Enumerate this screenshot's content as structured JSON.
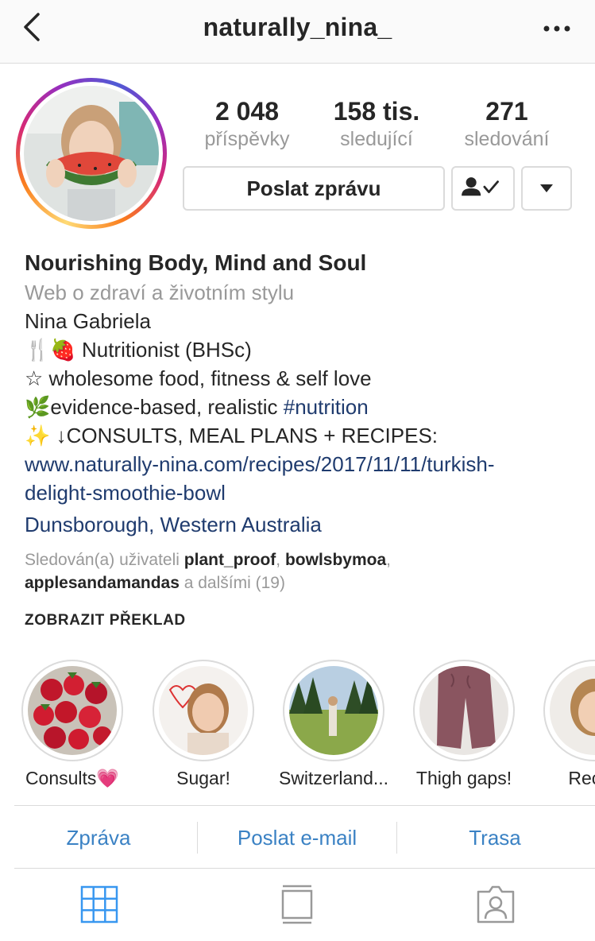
{
  "header": {
    "username": "naturally_nina_",
    "back_icon": "back-chevron-icon",
    "more_icon": "more-dots-icon"
  },
  "stats": [
    {
      "value": "2 048",
      "label": "příspěvky"
    },
    {
      "value": "158 tis.",
      "label": "sledující"
    },
    {
      "value": "271",
      "label": "sledování"
    }
  ],
  "actions": {
    "message_label": "Poslat zprávu",
    "following_icon": "person-check-icon",
    "dropdown_icon": "caret-down-icon"
  },
  "bio": {
    "title": "Nourishing Body, Mind and Soul",
    "category": "Web o zdraví a životním stylu",
    "name": "Nina Gabriela",
    "line1_emoji": "🍴🍓",
    "line1_text": " Nutritionist (BHSc)",
    "line2": "☆ wholesome food, fitness & self love",
    "line3_emoji": "🌿",
    "line3_text": "evidence-based, realistic ",
    "line3_hashtag": "#nutrition",
    "line4_emoji": "✨",
    "line4_text": " ↓CONSULTS, MEAL PLANS + RECIPES:",
    "link_line1": "www.naturally-nina.com/recipes/2017/11/11/turkish-",
    "link_line2": "delight-smoothie-bowl",
    "location": "Dunsborough, Western Australia",
    "followed_prefix": "Sledován(a) uživateli ",
    "followed_user1": "plant_proof",
    "followed_sep1": ", ",
    "followed_user2": "bowlsbymoa",
    "followed_sep2": ",",
    "followed_user3": "applesandamandas",
    "followed_suffix": " a dalšími (19)",
    "translate_label": "ZOBRAZIT PŘEKLAD"
  },
  "highlights": [
    {
      "label": "Consults💗"
    },
    {
      "label": "Sugar!"
    },
    {
      "label": "Switzerland..."
    },
    {
      "label": "Thigh gaps!"
    },
    {
      "label": "Recov"
    }
  ],
  "contact": {
    "message": "Zpráva",
    "email": "Poslat e-mail",
    "directions": "Trasa"
  },
  "tabs": {
    "grid_icon": "grid-icon",
    "feed_icon": "feed-icon",
    "tagged_icon": "tagged-person-icon",
    "active_color": "#3897f0"
  }
}
